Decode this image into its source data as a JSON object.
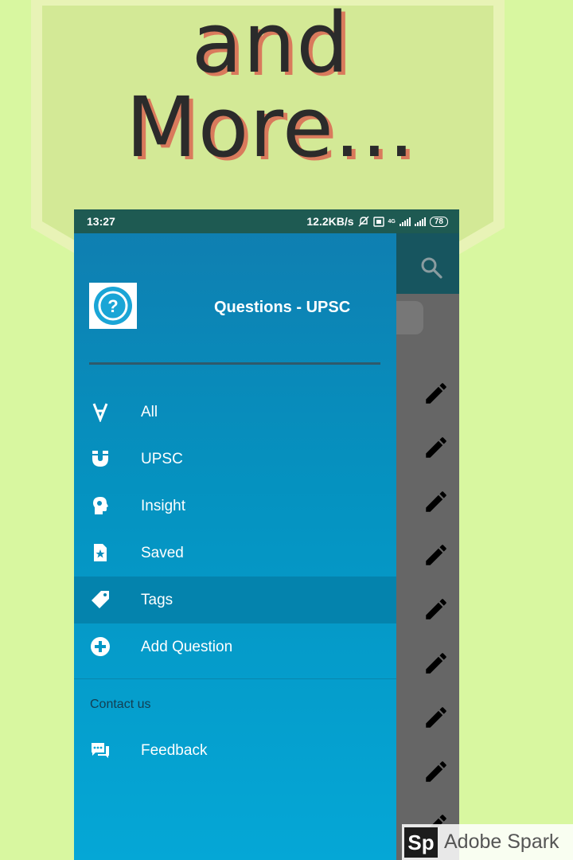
{
  "poster": {
    "line1": "and",
    "line2": "More..."
  },
  "statusbar": {
    "time": "13:27",
    "net_speed": "12.2KB/s",
    "battery": "78",
    "net_type": "4G"
  },
  "drawer": {
    "title": "Questions - UPSC",
    "items": [
      {
        "label": "All",
        "icon": "for-all-icon"
      },
      {
        "label": "UPSC",
        "icon": "magnet-icon"
      },
      {
        "label": "Insight",
        "icon": "head-brain-icon"
      },
      {
        "label": "Saved",
        "icon": "starred-file-icon"
      },
      {
        "label": "Tags",
        "icon": "tag-icon",
        "selected": true
      },
      {
        "label": "Add Question",
        "icon": "add-circle-icon"
      }
    ],
    "section_label": "Contact us",
    "contact_items": [
      {
        "label": "Feedback",
        "icon": "chat-bubbles-icon"
      }
    ]
  },
  "watermark": {
    "logo": "Sp",
    "text": "Adobe Spark"
  },
  "colors": {
    "background": "#d8f7a0",
    "drawer_top": "#0f7fb1",
    "drawer_bottom": "#05a7d6",
    "statusbar": "#1e5a52",
    "headline_shadow": "#d97a5c"
  }
}
